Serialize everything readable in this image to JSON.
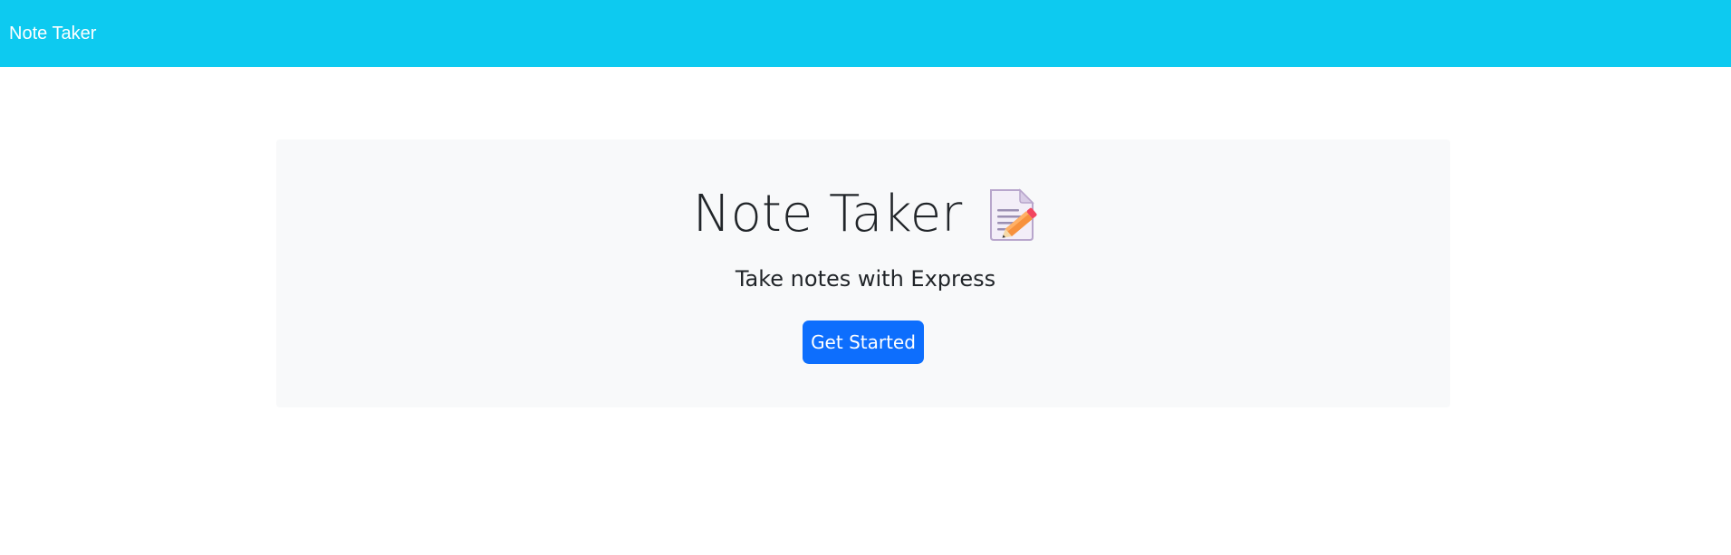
{
  "navbar": {
    "brand": "Note Taker",
    "background_color": "#0dcaf0"
  },
  "hero": {
    "title": "Note Taker",
    "title_icon": "memo-pencil-icon",
    "subtitle": "Take notes with Express",
    "cta_label": "Get Started",
    "cta_color": "#0d6efd",
    "panel_color": "#f8f9fa"
  }
}
